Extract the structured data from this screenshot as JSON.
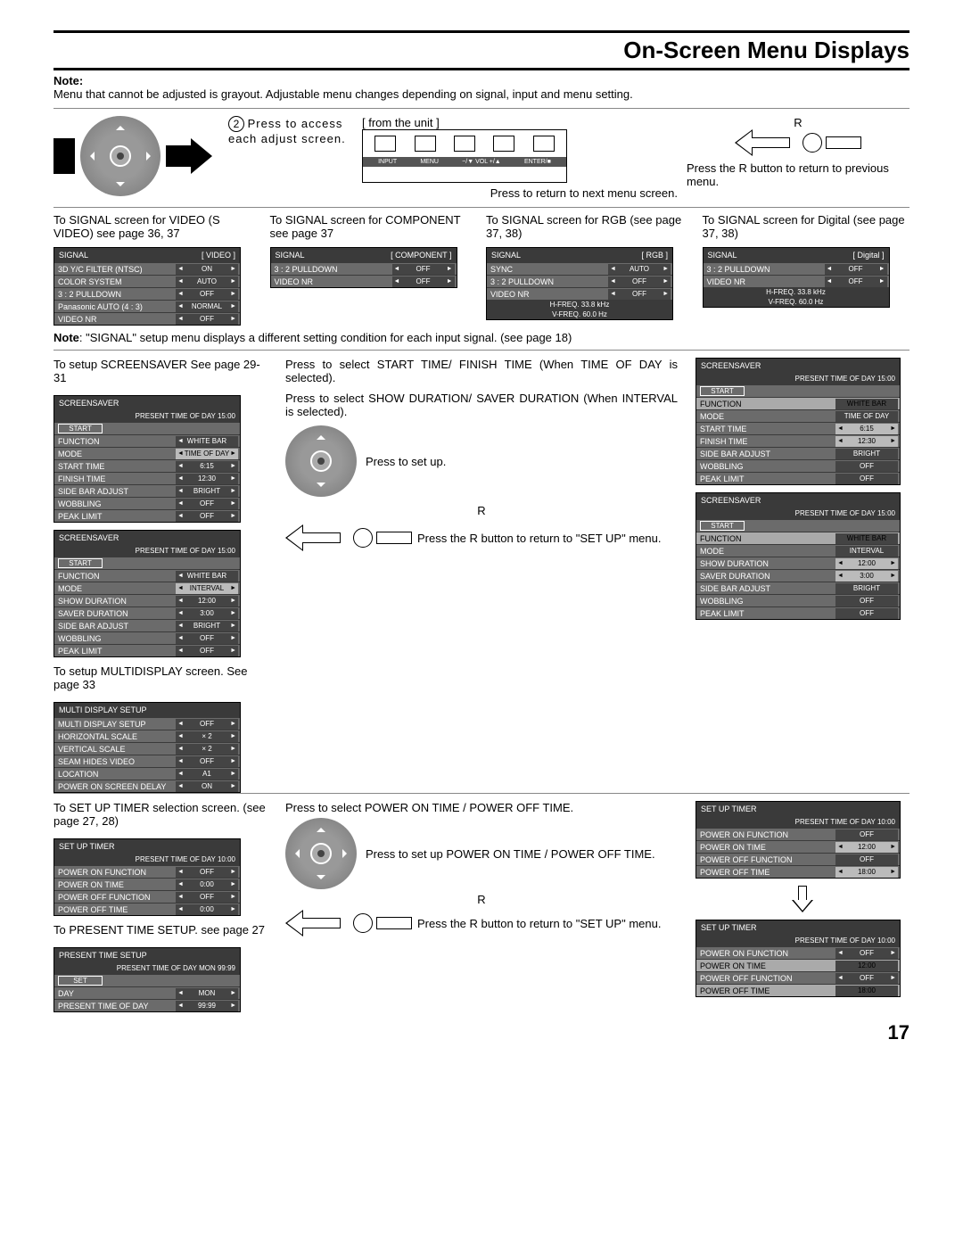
{
  "title": "On-Screen Menu Displays",
  "note_label": "Note:",
  "note_text": "Menu that cannot be adjusted is grayout. Adjustable menu changes depending on signal, input and menu setting.",
  "step2_num": "2",
  "step2_text": "Press to access each adjust screen.",
  "from_unit": "[ from the unit ]",
  "unit_labels": {
    "a": "INPUT",
    "b": "MENU",
    "c": "−/▼ VOL +/▲",
    "d": "ENTER/■"
  },
  "r_label": "R",
  "press_r_prev": "Press the R button to return to previous menu.",
  "press_return_next": "Press to return to next menu screen.",
  "signal_cols": [
    {
      "caption": "To SIGNAL screen for VIDEO (S VIDEO) see page 36, 37",
      "head_l": "SIGNAL",
      "head_r": "[ VIDEO ]",
      "rows": [
        {
          "l": "3D Y/C FILTER (NTSC)",
          "v": "ON"
        },
        {
          "l": "COLOR SYSTEM",
          "v": "AUTO"
        },
        {
          "l": "3 : 2 PULLDOWN",
          "v": "OFF"
        },
        {
          "l": "Panasonic AUTO (4 : 3)",
          "v": "NORMAL"
        },
        {
          "l": "VIDEO NR",
          "v": "OFF"
        }
      ]
    },
    {
      "caption": "To SIGNAL screen for COMPONENT see page 37",
      "head_l": "SIGNAL",
      "head_r": "[ COMPONENT ]",
      "rows": [
        {
          "l": "3 : 2 PULLDOWN",
          "v": "OFF"
        },
        {
          "l": "VIDEO NR",
          "v": "OFF"
        }
      ]
    },
    {
      "caption": "To SIGNAL screen for RGB (see page 37, 38)",
      "head_l": "SIGNAL",
      "head_r": "[ RGB ]",
      "rows": [
        {
          "l": "SYNC",
          "v": "AUTO"
        },
        {
          "l": "3 : 2 PULLDOWN",
          "v": "OFF"
        },
        {
          "l": "VIDEO NR",
          "v": "OFF"
        }
      ],
      "freq": [
        "H-FREQ.  33.8   kHz",
        "V-FREQ.  60.0   Hz"
      ]
    },
    {
      "caption": "To SIGNAL screen for Digital (see page 37, 38)",
      "head_l": "SIGNAL",
      "head_r": "[ Digital ]",
      "rows": [
        {
          "l": "3 : 2 PULLDOWN",
          "v": "OFF"
        },
        {
          "l": "VIDEO NR",
          "v": "OFF"
        }
      ],
      "freq": [
        "H-FREQ.  33.8   kHz",
        "V-FREQ.  60.0   Hz"
      ]
    }
  ],
  "signal_note_label": "Note",
  "signal_note": ":  \"SIGNAL\" setup menu displays a different setting condition for each input signal. (see page 18)",
  "ss_caption": "To setup SCREENSAVER See page 29-31",
  "ss_panel1": {
    "title": "SCREENSAVER",
    "sub": "PRESENT  TIME OF DAY    15:00",
    "rows": [
      {
        "l": "START",
        "start": true
      },
      {
        "l": "FUNCTION",
        "v": "WHITE BAR SCROLL"
      },
      {
        "l": "MODE",
        "v": "TIME OF DAY",
        "hl": true
      },
      {
        "l": "START TIME",
        "v": "6:15"
      },
      {
        "l": "FINISH TIME",
        "v": "12:30"
      },
      {
        "l": "SIDE BAR ADJUST",
        "v": "BRIGHT"
      },
      {
        "l": "WOBBLING",
        "v": "OFF"
      },
      {
        "l": "PEAK LIMIT",
        "v": "OFF"
      }
    ]
  },
  "ss_panel2": {
    "title": "SCREENSAVER",
    "sub": "PRESENT  TIME OF DAY    15:00",
    "rows": [
      {
        "l": "START",
        "start": true
      },
      {
        "l": "FUNCTION",
        "v": "WHITE BAR SCROLL"
      },
      {
        "l": "MODE",
        "v": "INTERVAL",
        "hl": true
      },
      {
        "l": "SHOW DURATION",
        "v": "12:00"
      },
      {
        "l": "SAVER DURATION",
        "v": "3:00"
      },
      {
        "l": "SIDE BAR ADJUST",
        "v": "BRIGHT"
      },
      {
        "l": "WOBBLING",
        "v": "OFF"
      },
      {
        "l": "PEAK LIMIT",
        "v": "OFF"
      }
    ]
  },
  "ss_select1": "Press to select START TIME/ FINISH TIME (When TIME OF DAY is selected).",
  "ss_select2": "Press to select SHOW DURATION/ SAVER DURATION (When INTERVAL is selected).",
  "press_setup": "Press to set up.",
  "press_r_setup": "Press the R button to return to \"SET UP\" menu.",
  "ss_panel3": {
    "title": "SCREENSAVER",
    "sub": "PRESENT  TIME OF DAY    15:00",
    "rows": [
      {
        "l": "START",
        "start": true
      },
      {
        "l": "FUNCTION",
        "v": "WHITE BAR SCROLL",
        "hlrow": true,
        "noarr": true
      },
      {
        "l": "MODE",
        "v": "TIME OF DAY",
        "noarr": true
      },
      {
        "l": "START TIME",
        "v": "6:15",
        "hl": true
      },
      {
        "l": "FINISH TIME",
        "v": "12:30",
        "hl": true
      },
      {
        "l": "SIDE BAR ADJUST",
        "v": "BRIGHT",
        "noarr": true
      },
      {
        "l": "WOBBLING",
        "v": "OFF",
        "noarr": true
      },
      {
        "l": "PEAK LIMIT",
        "v": "OFF",
        "noarr": true
      }
    ]
  },
  "ss_panel4": {
    "title": "SCREENSAVER",
    "sub": "PRESENT  TIME OF DAY    15:00",
    "rows": [
      {
        "l": "START",
        "start": true
      },
      {
        "l": "FUNCTION",
        "v": "WHITE BAR SCROLL",
        "hlrow": true,
        "noarr": true
      },
      {
        "l": "MODE",
        "v": "INTERVAL",
        "noarr": true
      },
      {
        "l": "SHOW DURATION",
        "v": "12:00",
        "hl": true
      },
      {
        "l": "SAVER DURATION",
        "v": "3:00",
        "hl": true
      },
      {
        "l": "SIDE BAR ADJUST",
        "v": "BRIGHT",
        "noarr": true
      },
      {
        "l": "WOBBLING",
        "v": "OFF",
        "noarr": true
      },
      {
        "l": "PEAK LIMIT",
        "v": "OFF",
        "noarr": true
      }
    ]
  },
  "md_caption": "To setup MULTIDISPLAY screen. See page 33",
  "md_panel": {
    "title": "MULTI DISPLAY SETUP",
    "sub": "",
    "rows": [
      {
        "l": "MULTI DISPLAY SETUP",
        "v": "OFF"
      },
      {
        "l": "HORIZONTAL SCALE",
        "v": "× 2"
      },
      {
        "l": "VERTICAL SCALE",
        "v": "× 2"
      },
      {
        "l": "SEAM HIDES VIDEO",
        "v": "OFF"
      },
      {
        "l": "LOCATION",
        "v": "A1"
      },
      {
        "l": "POWER ON SCREEN DELAY",
        "v": "ON"
      }
    ]
  },
  "timer_caption": "To SET UP TIMER selection screen. (see page 27, 28)",
  "timer_panel": {
    "title": "SET UP TIMER",
    "sub": "PRESENT  TIME OF DAY  10:00",
    "rows": [
      {
        "l": "POWER ON FUNCTION",
        "v": "OFF"
      },
      {
        "l": "POWER ON TIME",
        "v": "0:00"
      },
      {
        "l": "POWER OFF FUNCTION",
        "v": "OFF"
      },
      {
        "l": "POWER OFF TIME",
        "v": "0:00"
      }
    ]
  },
  "timer_select": "Press to select POWER ON TIME / POWER OFF TIME.",
  "timer_setup": "Press to set up POWER ON TIME / POWER OFF TIME.",
  "timer_panel_r1": {
    "title": "SET UP TIMER",
    "sub": "PRESENT  TIME OF DAY    10:00",
    "rows": [
      {
        "l": "POWER ON FUNCTION",
        "v": "OFF",
        "noarr": true
      },
      {
        "l": "POWER ON TIME",
        "v": "12:00",
        "hl": true
      },
      {
        "l": "POWER OFF FUNCTION",
        "v": "OFF",
        "noarr": true
      },
      {
        "l": "POWER OFF TIME",
        "v": "18:00",
        "hl": true
      }
    ]
  },
  "timer_panel_r2": {
    "title": "SET UP TIMER",
    "sub": "PRESENT  TIME OF DAY    10:00",
    "rows": [
      {
        "l": "POWER ON FUNCTION",
        "v": "OFF"
      },
      {
        "l": "POWER ON TIME",
        "v": "12:00",
        "hlrow": true,
        "noarr": true
      },
      {
        "l": "POWER OFF FUNCTION",
        "v": "OFF"
      },
      {
        "l": "POWER OFF TIME",
        "v": "18:00",
        "hlrow": true,
        "noarr": true
      }
    ]
  },
  "pts_caption": "To PRESENT TIME SETUP. see page 27",
  "pts_panel": {
    "title": "PRESENT  TIME SETUP",
    "sub": "PRESENT  TIME OF DAY    MON  99:99",
    "rows": [
      {
        "l": "SET",
        "start": true
      },
      {
        "l": "DAY",
        "v": "MON"
      },
      {
        "l": "PRESENT  TIME OF DAY",
        "v": "99:99"
      }
    ]
  },
  "page_num": "17"
}
